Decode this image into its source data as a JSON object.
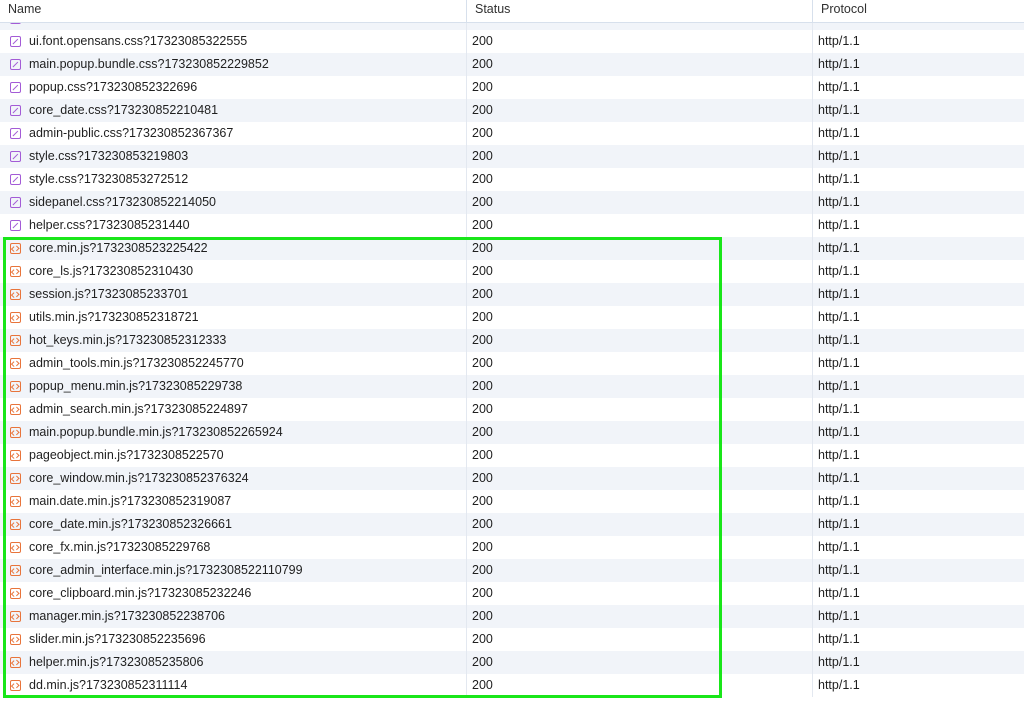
{
  "columns": {
    "name": "Name",
    "status": "Status",
    "protocol": "Protocol"
  },
  "rows": [
    {
      "name": "",
      "status": "",
      "protocol": "",
      "type": "css"
    },
    {
      "name": "ui.font.opensans.css?17323085322555",
      "status": "200",
      "protocol": "http/1.1",
      "type": "css"
    },
    {
      "name": "main.popup.bundle.css?173230852229852",
      "status": "200",
      "protocol": "http/1.1",
      "type": "css"
    },
    {
      "name": "popup.css?173230852322696",
      "status": "200",
      "protocol": "http/1.1",
      "type": "css"
    },
    {
      "name": "core_date.css?173230852210481",
      "status": "200",
      "protocol": "http/1.1",
      "type": "css"
    },
    {
      "name": "admin-public.css?173230852367367",
      "status": "200",
      "protocol": "http/1.1",
      "type": "css"
    },
    {
      "name": "style.css?173230853219803",
      "status": "200",
      "protocol": "http/1.1",
      "type": "css"
    },
    {
      "name": "style.css?173230853272512",
      "status": "200",
      "protocol": "http/1.1",
      "type": "css"
    },
    {
      "name": "sidepanel.css?173230852214050",
      "status": "200",
      "protocol": "http/1.1",
      "type": "css"
    },
    {
      "name": "helper.css?17323085231440",
      "status": "200",
      "protocol": "http/1.1",
      "type": "css"
    },
    {
      "name": "core.min.js?1732308523225422",
      "status": "200",
      "protocol": "http/1.1",
      "type": "js"
    },
    {
      "name": "core_ls.js?173230852310430",
      "status": "200",
      "protocol": "http/1.1",
      "type": "js"
    },
    {
      "name": "session.js?17323085233701",
      "status": "200",
      "protocol": "http/1.1",
      "type": "js"
    },
    {
      "name": "utils.min.js?173230852318721",
      "status": "200",
      "protocol": "http/1.1",
      "type": "js"
    },
    {
      "name": "hot_keys.min.js?173230852312333",
      "status": "200",
      "protocol": "http/1.1",
      "type": "js"
    },
    {
      "name": "admin_tools.min.js?173230852245770",
      "status": "200",
      "protocol": "http/1.1",
      "type": "js"
    },
    {
      "name": "popup_menu.min.js?17323085229738",
      "status": "200",
      "protocol": "http/1.1",
      "type": "js"
    },
    {
      "name": "admin_search.min.js?17323085224897",
      "status": "200",
      "protocol": "http/1.1",
      "type": "js"
    },
    {
      "name": "main.popup.bundle.min.js?173230852265924",
      "status": "200",
      "protocol": "http/1.1",
      "type": "js"
    },
    {
      "name": "pageobject.min.js?1732308522570",
      "status": "200",
      "protocol": "http/1.1",
      "type": "js"
    },
    {
      "name": "core_window.min.js?173230852376324",
      "status": "200",
      "protocol": "http/1.1",
      "type": "js"
    },
    {
      "name": "main.date.min.js?173230852319087",
      "status": "200",
      "protocol": "http/1.1",
      "type": "js"
    },
    {
      "name": "core_date.min.js?173230852326661",
      "status": "200",
      "protocol": "http/1.1",
      "type": "js"
    },
    {
      "name": "core_fx.min.js?17323085229768",
      "status": "200",
      "protocol": "http/1.1",
      "type": "js"
    },
    {
      "name": "core_admin_interface.min.js?1732308522110799",
      "status": "200",
      "protocol": "http/1.1",
      "type": "js"
    },
    {
      "name": "core_clipboard.min.js?17323085232246",
      "status": "200",
      "protocol": "http/1.1",
      "type": "js"
    },
    {
      "name": "manager.min.js?173230852238706",
      "status": "200",
      "protocol": "http/1.1",
      "type": "js"
    },
    {
      "name": "slider.min.js?173230852235696",
      "status": "200",
      "protocol": "http/1.1",
      "type": "js"
    },
    {
      "name": "helper.min.js?17323085235806",
      "status": "200",
      "protocol": "http/1.1",
      "type": "js"
    },
    {
      "name": "dd.min.js?173230852311114",
      "status": "200",
      "protocol": "http/1.1",
      "type": "js"
    }
  ],
  "colors": {
    "css_icon": "#a35bd6",
    "js_icon": "#e8743b",
    "highlight_border": "#19e619",
    "alt_row": "#f1f4f9"
  },
  "icons": {
    "css": "css-file-icon",
    "js": "js-file-icon"
  }
}
